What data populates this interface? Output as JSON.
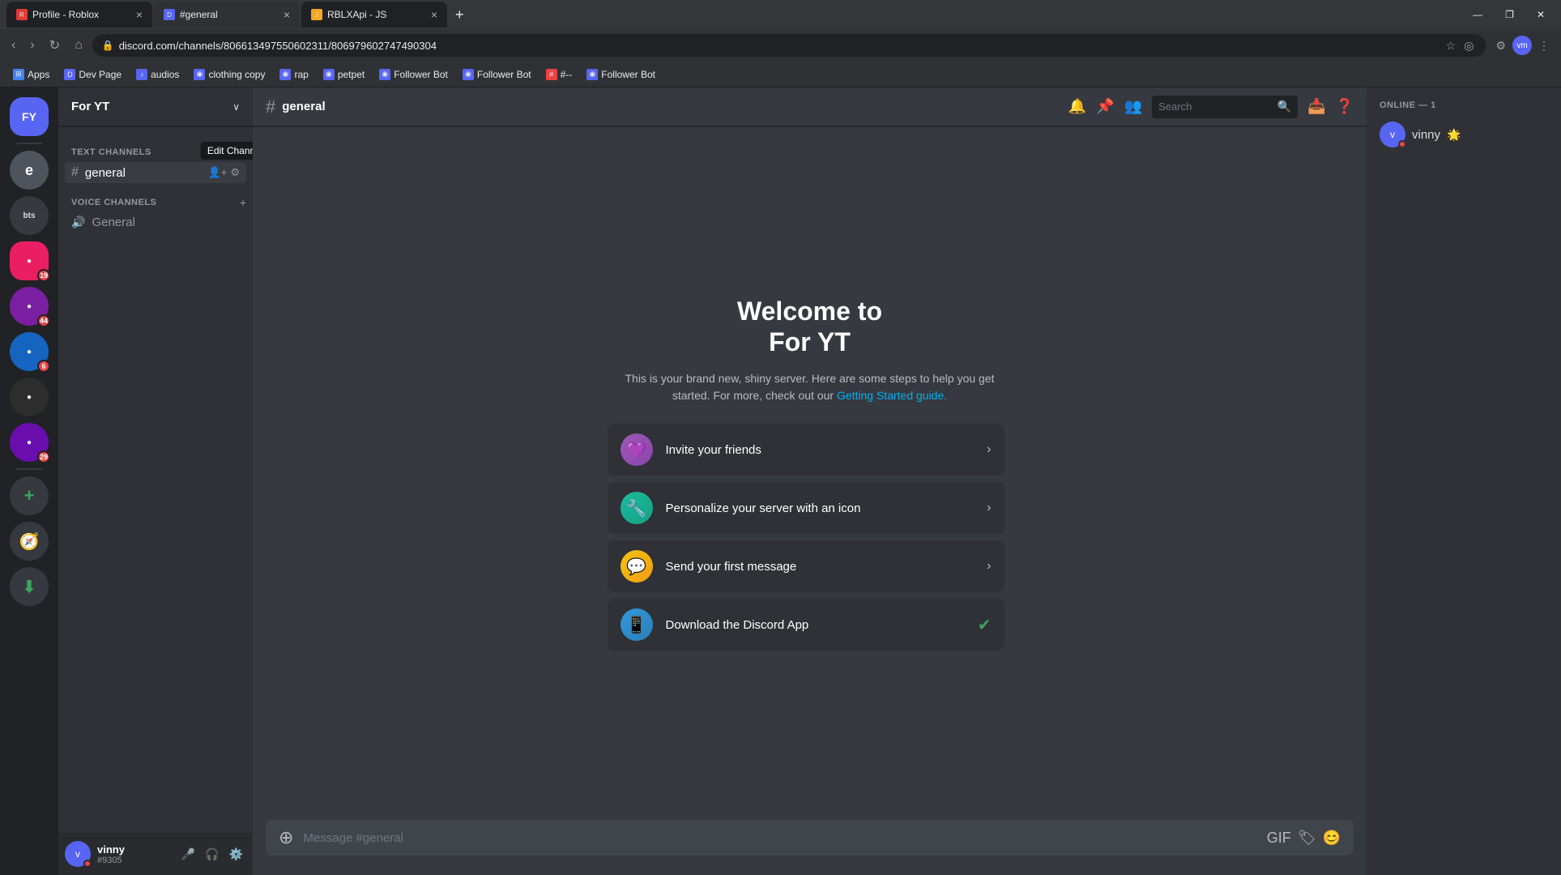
{
  "browser": {
    "tabs": [
      {
        "id": "tab1",
        "title": "Profile - Roblox",
        "favicon": "R",
        "favicon_bg": "#e53935",
        "active": false
      },
      {
        "id": "tab2",
        "title": "#general",
        "favicon": "D",
        "favicon_bg": "#5865f2",
        "active": true
      },
      {
        "id": "tab3",
        "title": "RBLXApi - JS",
        "favicon": "J",
        "favicon_bg": "#f5a623",
        "active": false
      }
    ],
    "url": "discord.com/channels/806613497550602311/806979602747490304",
    "bookmarks": [
      {
        "label": "Apps",
        "icon": "⊞",
        "icon_bg": "#4285f4"
      },
      {
        "label": "Dev Page",
        "icon": "D",
        "icon_bg": "#5865f2"
      },
      {
        "label": "audios",
        "icon": "♪",
        "icon_bg": "#5865f2"
      },
      {
        "label": "clothing copy",
        "icon": "◉",
        "icon_bg": "#5865f2"
      },
      {
        "label": "rap",
        "icon": "◉",
        "icon_bg": "#5865f2"
      },
      {
        "label": "petpet",
        "icon": "◉",
        "icon_bg": "#5865f2"
      },
      {
        "label": "Follower Bot",
        "icon": "◉",
        "icon_bg": "#5865f2"
      },
      {
        "label": "Follower Bot",
        "icon": "◉",
        "icon_bg": "#5865f2"
      },
      {
        "label": "#--",
        "icon": "#",
        "icon_bg": "#ed4245"
      },
      {
        "label": "Follower Bot",
        "icon": "◉",
        "icon_bg": "#5865f2"
      }
    ]
  },
  "discord": {
    "server_name": "For YT",
    "channel_name": "general",
    "channel_header": "general",
    "welcome_title_line1": "Welcome to",
    "welcome_title_line2": "For YT",
    "welcome_desc": "This is your brand new, shiny server. Here are some steps to help you get started. For more, check out our",
    "welcome_link": "Getting Started guide.",
    "text_channels_label": "TEXT CHANNELS",
    "voice_channels_label": "VOICE CHANNELS",
    "channels": [
      {
        "name": "general",
        "type": "text",
        "active": true
      }
    ],
    "voice_channels": [
      {
        "name": "General",
        "type": "voice"
      }
    ],
    "action_cards": [
      {
        "id": "invite",
        "label": "Invite your friends",
        "icon": "💜",
        "icon_class": "purple",
        "action": "arrow"
      },
      {
        "id": "personalize",
        "label": "Personalize your server with an icon",
        "icon": "🔧",
        "icon_class": "teal",
        "action": "arrow"
      },
      {
        "id": "message",
        "label": "Send your first message",
        "icon": "💬",
        "icon_class": "yellow",
        "action": "arrow"
      },
      {
        "id": "download",
        "label": "Download the Discord App",
        "icon": "📱",
        "icon_class": "blue",
        "action": "check"
      }
    ],
    "members_online_label": "ONLINE — 1",
    "members": [
      {
        "name": "vinny",
        "tag": "#9305",
        "status": "dnd",
        "badge": "🌟"
      }
    ],
    "user": {
      "name": "vinny",
      "tag": "#9305",
      "status": "dnd"
    },
    "message_placeholder": "Message #general",
    "servers": [
      {
        "id": "fy",
        "initials": "FY",
        "bg": "#5865f2",
        "active": true
      },
      {
        "id": "e",
        "initials": "e",
        "bg": "#4f545c"
      },
      {
        "id": "bts",
        "initials": "bts",
        "bg": "#36393f"
      },
      {
        "id": "srv4",
        "initials": "",
        "bg": "#e91e63",
        "badge": "19"
      },
      {
        "id": "srv5",
        "initials": "",
        "bg": "#9c27b0",
        "badge": "44"
      },
      {
        "id": "srv6",
        "initials": "",
        "bg": "#3f51b5",
        "badge": "6"
      },
      {
        "id": "srv7",
        "initials": "",
        "bg": "#009688"
      },
      {
        "id": "srv8",
        "initials": "",
        "bg": "#8e24aa",
        "badge": "29"
      }
    ],
    "edit_channel_tooltip": "Edit Channel",
    "search_placeholder": "Search"
  },
  "icons": {
    "bell": "🔔",
    "pin": "📌",
    "members": "👥",
    "search": "🔍",
    "inbox": "📥",
    "help": "❓",
    "mic": "🎤",
    "headphones": "🎧",
    "settings": "⚙️",
    "add_channel": "+",
    "voice": "🔊",
    "chevron_down": "∨",
    "arrow_right": "›",
    "check": "✓",
    "add_server": "+",
    "explore": "🧭",
    "download_icon": "⬇"
  }
}
